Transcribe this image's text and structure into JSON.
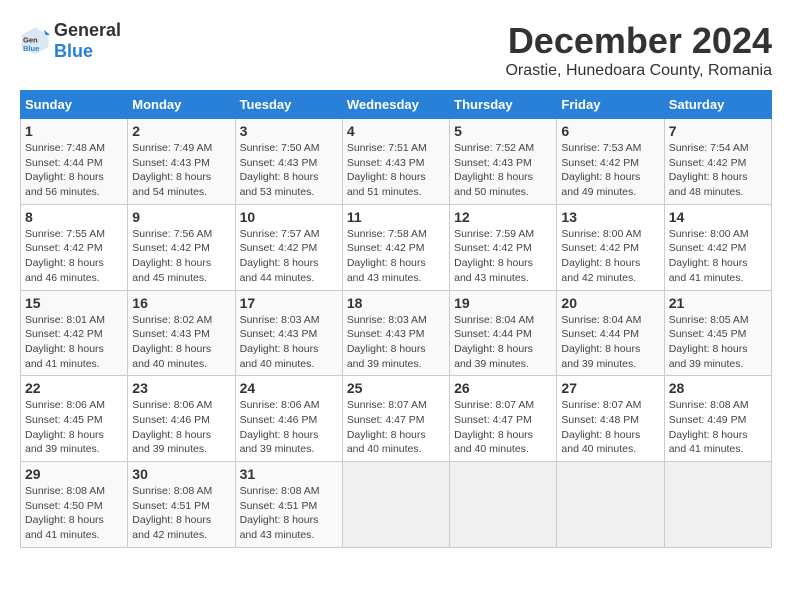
{
  "logo": {
    "general": "General",
    "blue": "Blue"
  },
  "header": {
    "title": "December 2024",
    "subtitle": "Orastie, Hunedoara County, Romania"
  },
  "days_of_week": [
    "Sunday",
    "Monday",
    "Tuesday",
    "Wednesday",
    "Thursday",
    "Friday",
    "Saturday"
  ],
  "weeks": [
    {
      "days": [
        {
          "number": "1",
          "sunrise": "Sunrise: 7:48 AM",
          "sunset": "Sunset: 4:44 PM",
          "daylight": "Daylight: 8 hours and 56 minutes."
        },
        {
          "number": "2",
          "sunrise": "Sunrise: 7:49 AM",
          "sunset": "Sunset: 4:43 PM",
          "daylight": "Daylight: 8 hours and 54 minutes."
        },
        {
          "number": "3",
          "sunrise": "Sunrise: 7:50 AM",
          "sunset": "Sunset: 4:43 PM",
          "daylight": "Daylight: 8 hours and 53 minutes."
        },
        {
          "number": "4",
          "sunrise": "Sunrise: 7:51 AM",
          "sunset": "Sunset: 4:43 PM",
          "daylight": "Daylight: 8 hours and 51 minutes."
        },
        {
          "number": "5",
          "sunrise": "Sunrise: 7:52 AM",
          "sunset": "Sunset: 4:43 PM",
          "daylight": "Daylight: 8 hours and 50 minutes."
        },
        {
          "number": "6",
          "sunrise": "Sunrise: 7:53 AM",
          "sunset": "Sunset: 4:42 PM",
          "daylight": "Daylight: 8 hours and 49 minutes."
        },
        {
          "number": "7",
          "sunrise": "Sunrise: 7:54 AM",
          "sunset": "Sunset: 4:42 PM",
          "daylight": "Daylight: 8 hours and 48 minutes."
        }
      ]
    },
    {
      "days": [
        {
          "number": "8",
          "sunrise": "Sunrise: 7:55 AM",
          "sunset": "Sunset: 4:42 PM",
          "daylight": "Daylight: 8 hours and 46 minutes."
        },
        {
          "number": "9",
          "sunrise": "Sunrise: 7:56 AM",
          "sunset": "Sunset: 4:42 PM",
          "daylight": "Daylight: 8 hours and 45 minutes."
        },
        {
          "number": "10",
          "sunrise": "Sunrise: 7:57 AM",
          "sunset": "Sunset: 4:42 PM",
          "daylight": "Daylight: 8 hours and 44 minutes."
        },
        {
          "number": "11",
          "sunrise": "Sunrise: 7:58 AM",
          "sunset": "Sunset: 4:42 PM",
          "daylight": "Daylight: 8 hours and 43 minutes."
        },
        {
          "number": "12",
          "sunrise": "Sunrise: 7:59 AM",
          "sunset": "Sunset: 4:42 PM",
          "daylight": "Daylight: 8 hours and 43 minutes."
        },
        {
          "number": "13",
          "sunrise": "Sunrise: 8:00 AM",
          "sunset": "Sunset: 4:42 PM",
          "daylight": "Daylight: 8 hours and 42 minutes."
        },
        {
          "number": "14",
          "sunrise": "Sunrise: 8:00 AM",
          "sunset": "Sunset: 4:42 PM",
          "daylight": "Daylight: 8 hours and 41 minutes."
        }
      ]
    },
    {
      "days": [
        {
          "number": "15",
          "sunrise": "Sunrise: 8:01 AM",
          "sunset": "Sunset: 4:42 PM",
          "daylight": "Daylight: 8 hours and 41 minutes."
        },
        {
          "number": "16",
          "sunrise": "Sunrise: 8:02 AM",
          "sunset": "Sunset: 4:43 PM",
          "daylight": "Daylight: 8 hours and 40 minutes."
        },
        {
          "number": "17",
          "sunrise": "Sunrise: 8:03 AM",
          "sunset": "Sunset: 4:43 PM",
          "daylight": "Daylight: 8 hours and 40 minutes."
        },
        {
          "number": "18",
          "sunrise": "Sunrise: 8:03 AM",
          "sunset": "Sunset: 4:43 PM",
          "daylight": "Daylight: 8 hours and 39 minutes."
        },
        {
          "number": "19",
          "sunrise": "Sunrise: 8:04 AM",
          "sunset": "Sunset: 4:44 PM",
          "daylight": "Daylight: 8 hours and 39 minutes."
        },
        {
          "number": "20",
          "sunrise": "Sunrise: 8:04 AM",
          "sunset": "Sunset: 4:44 PM",
          "daylight": "Daylight: 8 hours and 39 minutes."
        },
        {
          "number": "21",
          "sunrise": "Sunrise: 8:05 AM",
          "sunset": "Sunset: 4:45 PM",
          "daylight": "Daylight: 8 hours and 39 minutes."
        }
      ]
    },
    {
      "days": [
        {
          "number": "22",
          "sunrise": "Sunrise: 8:06 AM",
          "sunset": "Sunset: 4:45 PM",
          "daylight": "Daylight: 8 hours and 39 minutes."
        },
        {
          "number": "23",
          "sunrise": "Sunrise: 8:06 AM",
          "sunset": "Sunset: 4:46 PM",
          "daylight": "Daylight: 8 hours and 39 minutes."
        },
        {
          "number": "24",
          "sunrise": "Sunrise: 8:06 AM",
          "sunset": "Sunset: 4:46 PM",
          "daylight": "Daylight: 8 hours and 39 minutes."
        },
        {
          "number": "25",
          "sunrise": "Sunrise: 8:07 AM",
          "sunset": "Sunset: 4:47 PM",
          "daylight": "Daylight: 8 hours and 40 minutes."
        },
        {
          "number": "26",
          "sunrise": "Sunrise: 8:07 AM",
          "sunset": "Sunset: 4:47 PM",
          "daylight": "Daylight: 8 hours and 40 minutes."
        },
        {
          "number": "27",
          "sunrise": "Sunrise: 8:07 AM",
          "sunset": "Sunset: 4:48 PM",
          "daylight": "Daylight: 8 hours and 40 minutes."
        },
        {
          "number": "28",
          "sunrise": "Sunrise: 8:08 AM",
          "sunset": "Sunset: 4:49 PM",
          "daylight": "Daylight: 8 hours and 41 minutes."
        }
      ]
    },
    {
      "days": [
        {
          "number": "29",
          "sunrise": "Sunrise: 8:08 AM",
          "sunset": "Sunset: 4:50 PM",
          "daylight": "Daylight: 8 hours and 41 minutes."
        },
        {
          "number": "30",
          "sunrise": "Sunrise: 8:08 AM",
          "sunset": "Sunset: 4:51 PM",
          "daylight": "Daylight: 8 hours and 42 minutes."
        },
        {
          "number": "31",
          "sunrise": "Sunrise: 8:08 AM",
          "sunset": "Sunset: 4:51 PM",
          "daylight": "Daylight: 8 hours and 43 minutes."
        },
        null,
        null,
        null,
        null
      ]
    }
  ]
}
